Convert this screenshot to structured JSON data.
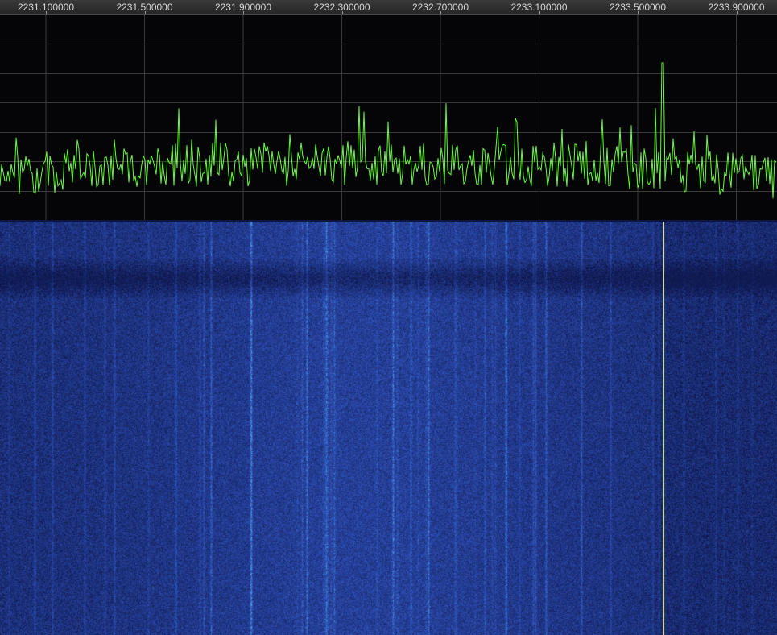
{
  "window": {
    "app": "SDR spectrum / waterfall display"
  },
  "frequency_axis": {
    "labels": [
      "2231.100000",
      "2231.500000",
      "2231.900000",
      "2232.300000",
      "2232.700000",
      "2233.100000",
      "2233.500000",
      "2233.900000"
    ],
    "start_mhz": 2231.1,
    "step_mhz": 0.4
  },
  "spectrum": {
    "trace_color": "#66ff33",
    "grid_color": "#3a3a3a",
    "background_color": "#050507"
  },
  "waterfall": {
    "base_color": "#1d2f7a",
    "highlight_color": "#4fc3ff"
  },
  "marker": {
    "frequency_mhz": 2233.6,
    "color": "#f4ffb0"
  }
}
